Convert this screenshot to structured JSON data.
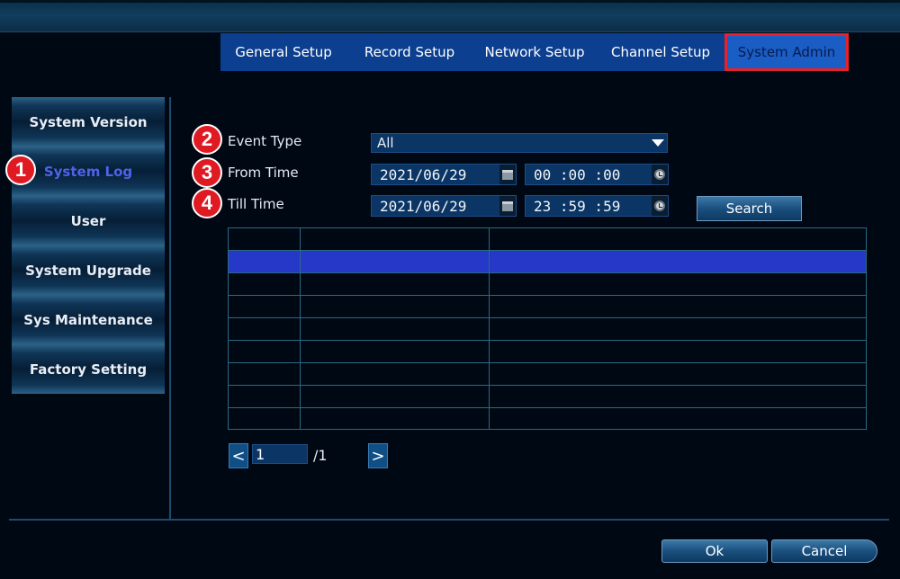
{
  "tabs": [
    {
      "label": "General Setup",
      "active": false
    },
    {
      "label": "Record Setup",
      "active": false
    },
    {
      "label": "Network Setup",
      "active": false
    },
    {
      "label": "Channel Setup",
      "active": false
    },
    {
      "label": "System Admin",
      "active": true
    }
  ],
  "sidebar": {
    "items": [
      {
        "label": "System Version"
      },
      {
        "label": "System Log",
        "active": true
      },
      {
        "label": "User"
      },
      {
        "label": "System Upgrade"
      },
      {
        "label": "Sys Maintenance"
      },
      {
        "label": "Factory Setting"
      }
    ]
  },
  "badges": [
    "1",
    "2",
    "3",
    "4"
  ],
  "form": {
    "event_type_label": "Event Type",
    "event_type_value": "All",
    "from_time_label": "From Time",
    "from_date": "2021/06/29",
    "from_time": "00 :00 :00",
    "till_time_label": "Till Time",
    "till_date": "2021/06/29",
    "till_time": "23 :59 :59",
    "search_label": "Search"
  },
  "log_table": {
    "row_count": 9,
    "selected_row": 1
  },
  "pager": {
    "prev_glyph": "<",
    "next_glyph": ">",
    "current_page": "1",
    "total_pages": "/1"
  },
  "footer": {
    "ok_label": "Ok",
    "cancel_label": "Cancel"
  },
  "colors": {
    "tab_bar": "#0c3f8f",
    "highlight_border": "#e8202a",
    "selected_row": "#2638c8",
    "active_sidebar_text": "#4e63e8"
  }
}
